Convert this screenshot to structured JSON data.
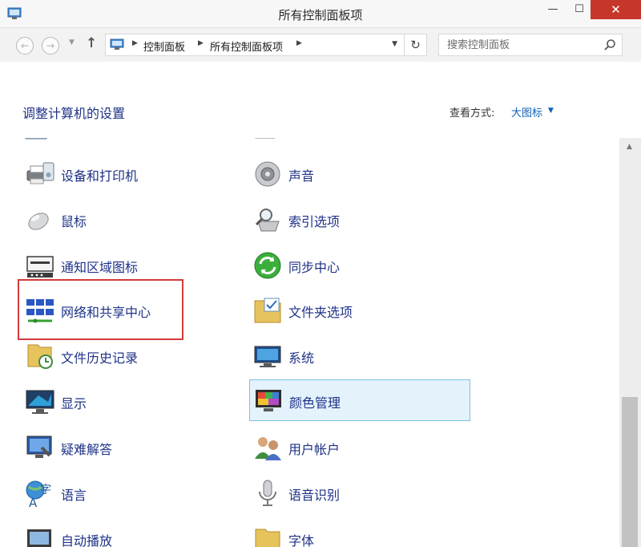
{
  "window": {
    "title": "所有控制面板项",
    "minimize_glyph": "—",
    "maximize_glyph": "☐",
    "close_glyph": "✕"
  },
  "nav": {
    "back_glyph": "←",
    "forward_glyph": "→",
    "dropdown_glyph": "▼",
    "up_glyph": "↑",
    "refresh_glyph": "↻"
  },
  "breadcrumb": [
    "控制面板",
    "所有控制面板项"
  ],
  "search": {
    "placeholder": "搜索控制面板"
  },
  "header": {
    "heading": "调整计算机的设置",
    "view_label": "查看方式:",
    "view_value": "大图标",
    "caret": "▼"
  },
  "items_left": [
    {
      "label": "设备和打印机",
      "icon": "printer-icon"
    },
    {
      "label": "鼠标",
      "icon": "mouse-icon"
    },
    {
      "label": "通知区域图标",
      "icon": "notification-tray-icon"
    },
    {
      "label": "网络和共享中心",
      "icon": "network-icon"
    },
    {
      "label": "文件历史记录",
      "icon": "file-history-icon"
    },
    {
      "label": "显示",
      "icon": "display-icon"
    },
    {
      "label": "疑难解答",
      "icon": "troubleshoot-icon"
    },
    {
      "label": "语言",
      "icon": "language-icon"
    },
    {
      "label": "自动播放",
      "icon": "autoplay-icon"
    }
  ],
  "items_right": [
    {
      "label": "声音",
      "icon": "speaker-icon"
    },
    {
      "label": "索引选项",
      "icon": "indexing-icon"
    },
    {
      "label": "同步中心",
      "icon": "sync-icon"
    },
    {
      "label": "文件夹选项",
      "icon": "folder-options-icon"
    },
    {
      "label": "系统",
      "icon": "system-icon"
    },
    {
      "label": "颜色管理",
      "icon": "color-management-icon"
    },
    {
      "label": "用户帐户",
      "icon": "users-icon"
    },
    {
      "label": "语音识别",
      "icon": "microphone-icon"
    },
    {
      "label": "字体",
      "icon": "fonts-icon"
    }
  ],
  "colors": {
    "link": "#1e3287",
    "highlight_border": "#d23b3b",
    "hover_border": "#7ec1e6",
    "close_button": "#c7362a"
  }
}
